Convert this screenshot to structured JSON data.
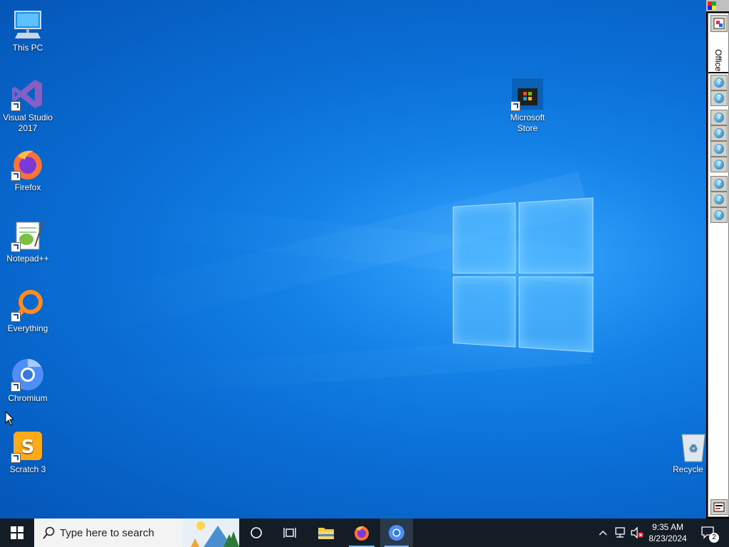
{
  "desktop": {
    "icons_left": [
      {
        "label": "This PC",
        "icon": "computer-icon"
      },
      {
        "label": "Visual Studio 2017",
        "icon": "visual-studio-icon"
      },
      {
        "label": "Firefox",
        "icon": "firefox-icon"
      },
      {
        "label": "Notepad++",
        "icon": "notepadpp-icon"
      },
      {
        "label": "Everything",
        "icon": "everything-icon"
      },
      {
        "label": "Chromium",
        "icon": "chromium-icon"
      },
      {
        "label": "Scratch 3",
        "icon": "scratch-icon"
      }
    ],
    "store": {
      "label": "Microsoft Store",
      "icon": "store-icon"
    },
    "recycle": {
      "label": "Recycle B",
      "icon": "recycle-bin-icon"
    }
  },
  "office_bar": {
    "label": "Office",
    "button_glyph": "?"
  },
  "taskbar": {
    "search_placeholder": "Type here to search",
    "time": "9:35 AM",
    "date": "8/23/2024",
    "notification_count": "2",
    "colors": {
      "taskbar_bg": "#141d26",
      "accent": "#7cb7ff"
    }
  }
}
